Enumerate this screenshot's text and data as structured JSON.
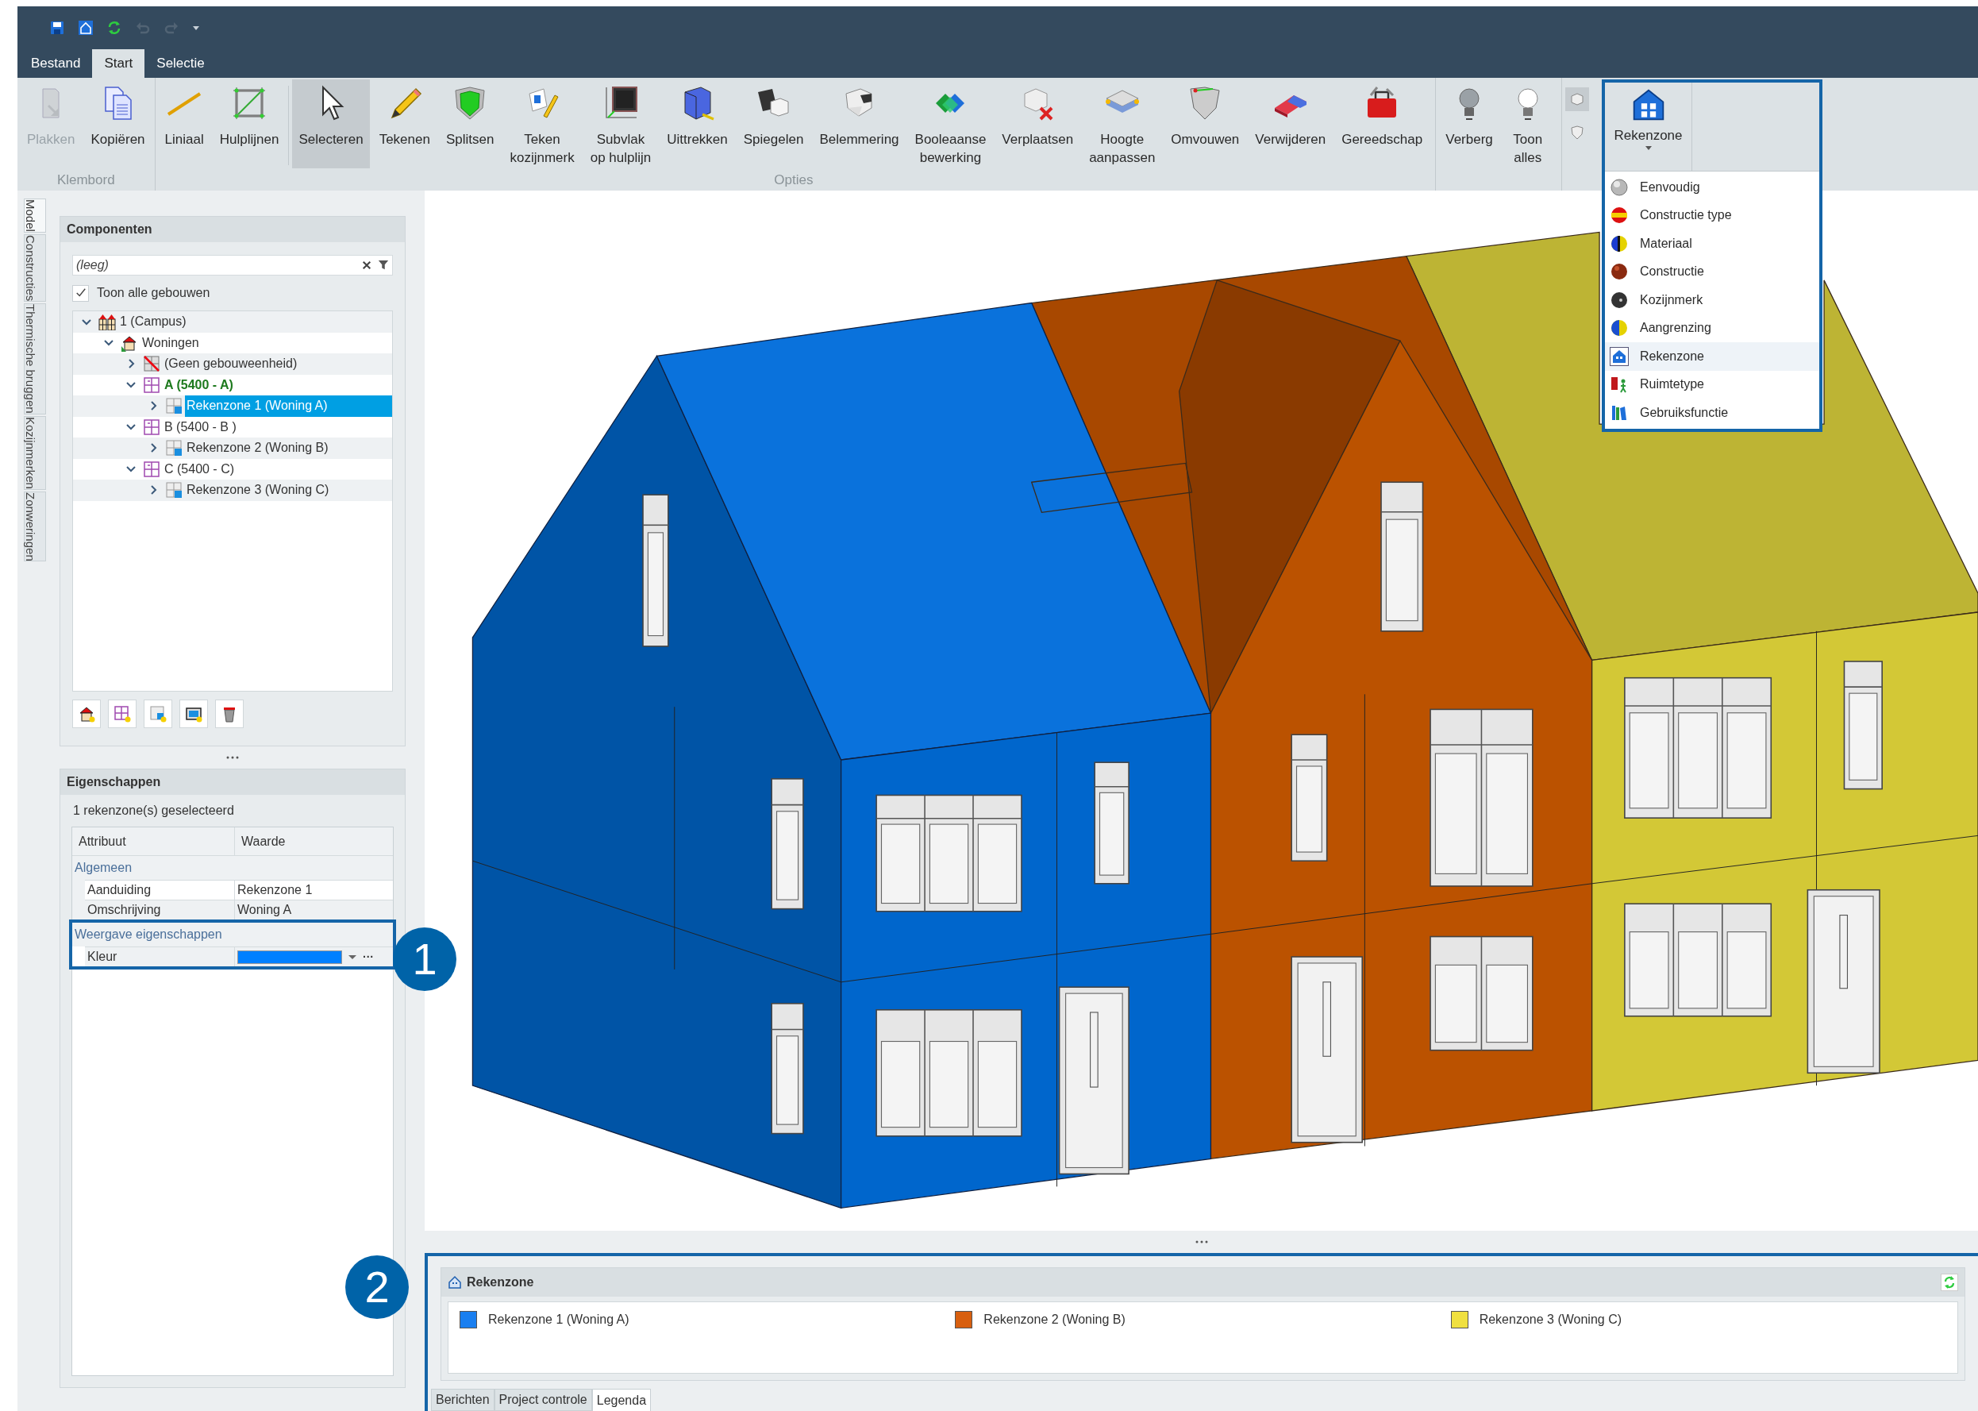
{
  "quick_access": [
    {
      "kind": "save",
      "disabled": false
    },
    {
      "kind": "home",
      "disabled": false
    },
    {
      "kind": "refresh",
      "disabled": false
    },
    {
      "kind": "undo",
      "disabled": true
    },
    {
      "kind": "redo",
      "disabled": true
    }
  ],
  "ribbon_tabs": [
    {
      "label": "Bestand",
      "selected": false
    },
    {
      "label": "Start",
      "selected": true
    },
    {
      "label": "Selectie",
      "selected": false
    }
  ],
  "ribbon_groups": [
    {
      "label": "Klembord",
      "buttons": [
        {
          "label": "Plakken",
          "selected": false,
          "disabled": true
        },
        {
          "label": "Kopiëren",
          "selected": false,
          "disabled": false
        }
      ]
    },
    {
      "label": "Opties",
      "buttons": [
        {
          "label": "Liniaal",
          "selected": false,
          "disabled": false
        },
        {
          "label": "Hulplijnen",
          "selected": false,
          "disabled": false
        },
        {
          "label": "Selecteren",
          "selected": true,
          "disabled": false
        },
        {
          "label": "Tekenen",
          "selected": false,
          "disabled": false
        },
        {
          "label": "Splitsen",
          "selected": false,
          "disabled": false
        },
        {
          "label": "Teken\nkozijnmerk",
          "selected": false,
          "disabled": false
        },
        {
          "label": "Subvlak\nop hulplijn",
          "selected": false,
          "disabled": false
        },
        {
          "label": "Uittrekken",
          "selected": false,
          "disabled": false
        },
        {
          "label": "Spiegelen",
          "selected": false,
          "disabled": false
        },
        {
          "label": "Belemmering",
          "selected": false,
          "disabled": false
        },
        {
          "label": "Booleaanse\nbewerking",
          "selected": false,
          "disabled": false
        },
        {
          "label": "Verplaatsen",
          "selected": false,
          "disabled": false
        },
        {
          "label": "Hoogte\naanpassen",
          "selected": false,
          "disabled": false
        },
        {
          "label": "Omvouwen",
          "selected": false,
          "disabled": false
        },
        {
          "label": "Verwijderen",
          "selected": false,
          "disabled": false
        },
        {
          "label": "Gereedschap",
          "selected": false,
          "disabled": false
        }
      ]
    },
    {
      "buttons": [
        {
          "label": "Verberg",
          "selected": false,
          "disabled": false
        },
        {
          "label": "Toon\nalles",
          "selected": false,
          "disabled": false
        }
      ]
    }
  ],
  "view_toggles": [
    {
      "selected": true
    },
    {
      "selected": false
    }
  ],
  "display_menu": {
    "button": "Rekenzone",
    "items": [
      {
        "label": "Eenvoudig",
        "selected": false
      },
      {
        "label": "Constructie type",
        "selected": false
      },
      {
        "label": "Materiaal",
        "selected": false
      },
      {
        "label": "Constructie",
        "selected": false
      },
      {
        "label": "Kozijnmerk",
        "selected": false
      },
      {
        "label": "Aangrenzing",
        "selected": false
      },
      {
        "label": "Rekenzone",
        "selected": true
      },
      {
        "label": "Ruimtetype",
        "selected": false
      },
      {
        "label": "Gebruiksfunctie",
        "selected": false
      }
    ]
  },
  "side_tabs": [
    {
      "label": "Model",
      "selected": true
    },
    {
      "label": "Constructies",
      "selected": false
    },
    {
      "label": "Thermische bruggen",
      "selected": false
    },
    {
      "label": "Kozijnmerken",
      "selected": false
    },
    {
      "label": "Zonweringen",
      "selected": false
    }
  ],
  "components": {
    "title": "Componenten",
    "search": {
      "placeholder": "(leeg)"
    },
    "show_all": {
      "label": "Toon alle gebouwen",
      "checked": true
    },
    "tree": [
      {
        "label": "1 (Campus)",
        "kind": "campus",
        "expanded": true,
        "selected": false,
        "active": false,
        "children": [
          {
            "label": "Woningen",
            "kind": "housing",
            "expanded": true,
            "selected": false,
            "active": false,
            "children": [
              {
                "label": "(Geen gebouweenheid)",
                "kind": "no-unit",
                "expanded": false,
                "selected": false,
                "active": false
              },
              {
                "label": "A (5400 - A)",
                "kind": "unit",
                "expanded": true,
                "selected": false,
                "active": true,
                "children": [
                  {
                    "label": "Rekenzone 1 (Woning A)",
                    "kind": "zone",
                    "expanded": false,
                    "selected": true,
                    "active": false
                  }
                ]
              },
              {
                "label": "B (5400 - B )",
                "kind": "unit",
                "expanded": true,
                "selected": false,
                "active": false,
                "children": [
                  {
                    "label": "Rekenzone 2 (Woning B)",
                    "kind": "zone",
                    "expanded": false,
                    "selected": false,
                    "active": false
                  }
                ]
              },
              {
                "label": "C (5400 - C)",
                "kind": "unit",
                "expanded": true,
                "selected": false,
                "active": false,
                "children": [
                  {
                    "label": "Rekenzone 3 (Woning C)",
                    "kind": "zone",
                    "expanded": false,
                    "selected": false,
                    "active": false
                  }
                ]
              }
            ]
          }
        ]
      }
    ]
  },
  "properties": {
    "title": "Eigenschappen",
    "summary": "1 rekenzone(s) geselecteerd",
    "columns": [
      "Attribuut",
      "Waarde"
    ],
    "categories": [
      {
        "label": "Algemeen",
        "highlighted": false,
        "rows": [
          {
            "kind": "text",
            "attribute": "Aanduiding",
            "value": "Rekenzone 1"
          },
          {
            "kind": "text",
            "attribute": "Omschrijving",
            "value": "Woning A"
          }
        ]
      },
      {
        "label": "Weergave eigenschappen",
        "highlighted": true,
        "rows": [
          {
            "kind": "color",
            "attribute": "Kleur",
            "color": "#0080ff",
            "action": "···"
          }
        ]
      }
    ]
  },
  "callouts": [
    {
      "label": "1"
    },
    {
      "label": "2"
    }
  ],
  "legend": {
    "title": "Rekenzone",
    "items": [
      {
        "label": "Rekenzone 1 (Woning A)",
        "color": "#1a7ff0"
      },
      {
        "label": "Rekenzone 2 (Woning B)",
        "color": "#d85f0f"
      },
      {
        "label": "Rekenzone 3 (Woning C)",
        "color": "#f0e040"
      }
    ],
    "tabs": [
      {
        "label": "Berichten",
        "selected": false
      },
      {
        "label": "Project controle",
        "selected": false
      },
      {
        "label": "Legenda",
        "selected": true
      }
    ]
  }
}
